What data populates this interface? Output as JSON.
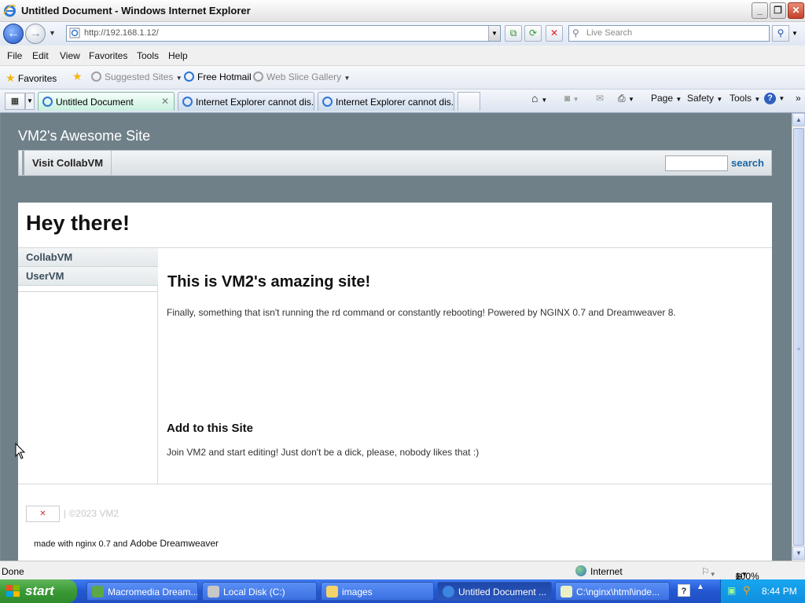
{
  "window": {
    "title": "Untitled Document - Windows Internet Explorer"
  },
  "address_bar": {
    "url": "http://192.168.1.12/",
    "search_placeholder": "Live Search"
  },
  "menu": [
    "File",
    "Edit",
    "View",
    "Favorites",
    "Tools",
    "Help"
  ],
  "favorites_bar": {
    "favorites_label": "Favorites",
    "suggested_sites": "Suggested Sites",
    "free_hotmail": "Free Hotmail",
    "web_slice_gallery": "Web Slice Gallery"
  },
  "tabs": [
    {
      "label": "Untitled Document"
    },
    {
      "label": "Internet Explorer cannot dis..."
    },
    {
      "label": "Internet Explorer cannot dis..."
    }
  ],
  "command_bar": {
    "page": "Page",
    "safety": "Safety",
    "tools": "Tools"
  },
  "site": {
    "title": "VM2's Awesome Site",
    "nav_link": "Visit CollabVM",
    "search_button": "search",
    "heading": "Hey there!",
    "sidebar_links": [
      "CollabVM",
      "UserVM"
    ],
    "main_heading": "This is VM2's amazing site!",
    "main_text": "Finally, something that isn't running the rd command or constantly rebooting! Powered by NGINX 0.7 and Dreamweaver 8.",
    "sub_heading": "Add to this Site",
    "sub_text": "Join VM2 and start editing! Just don't be a dick, please, nobody likes that :)",
    "footer_copyright": "| ©2023 VM2",
    "footer_made_prefix": "made with nginx 0.7 and",
    "footer_made_link": "Adobe Dreamweaver"
  },
  "status_bar": {
    "status": "Done",
    "zone": "Internet",
    "zoom": "100%"
  },
  "taskbar": {
    "start": "start",
    "items": [
      {
        "label": "Macromedia Dream..."
      },
      {
        "label": "Local Disk (C:)"
      },
      {
        "label": "images"
      },
      {
        "label": "Untitled Document ..."
      },
      {
        "label": "C:\\nginx\\html\\inde..."
      }
    ],
    "clock": "8:44 PM"
  }
}
